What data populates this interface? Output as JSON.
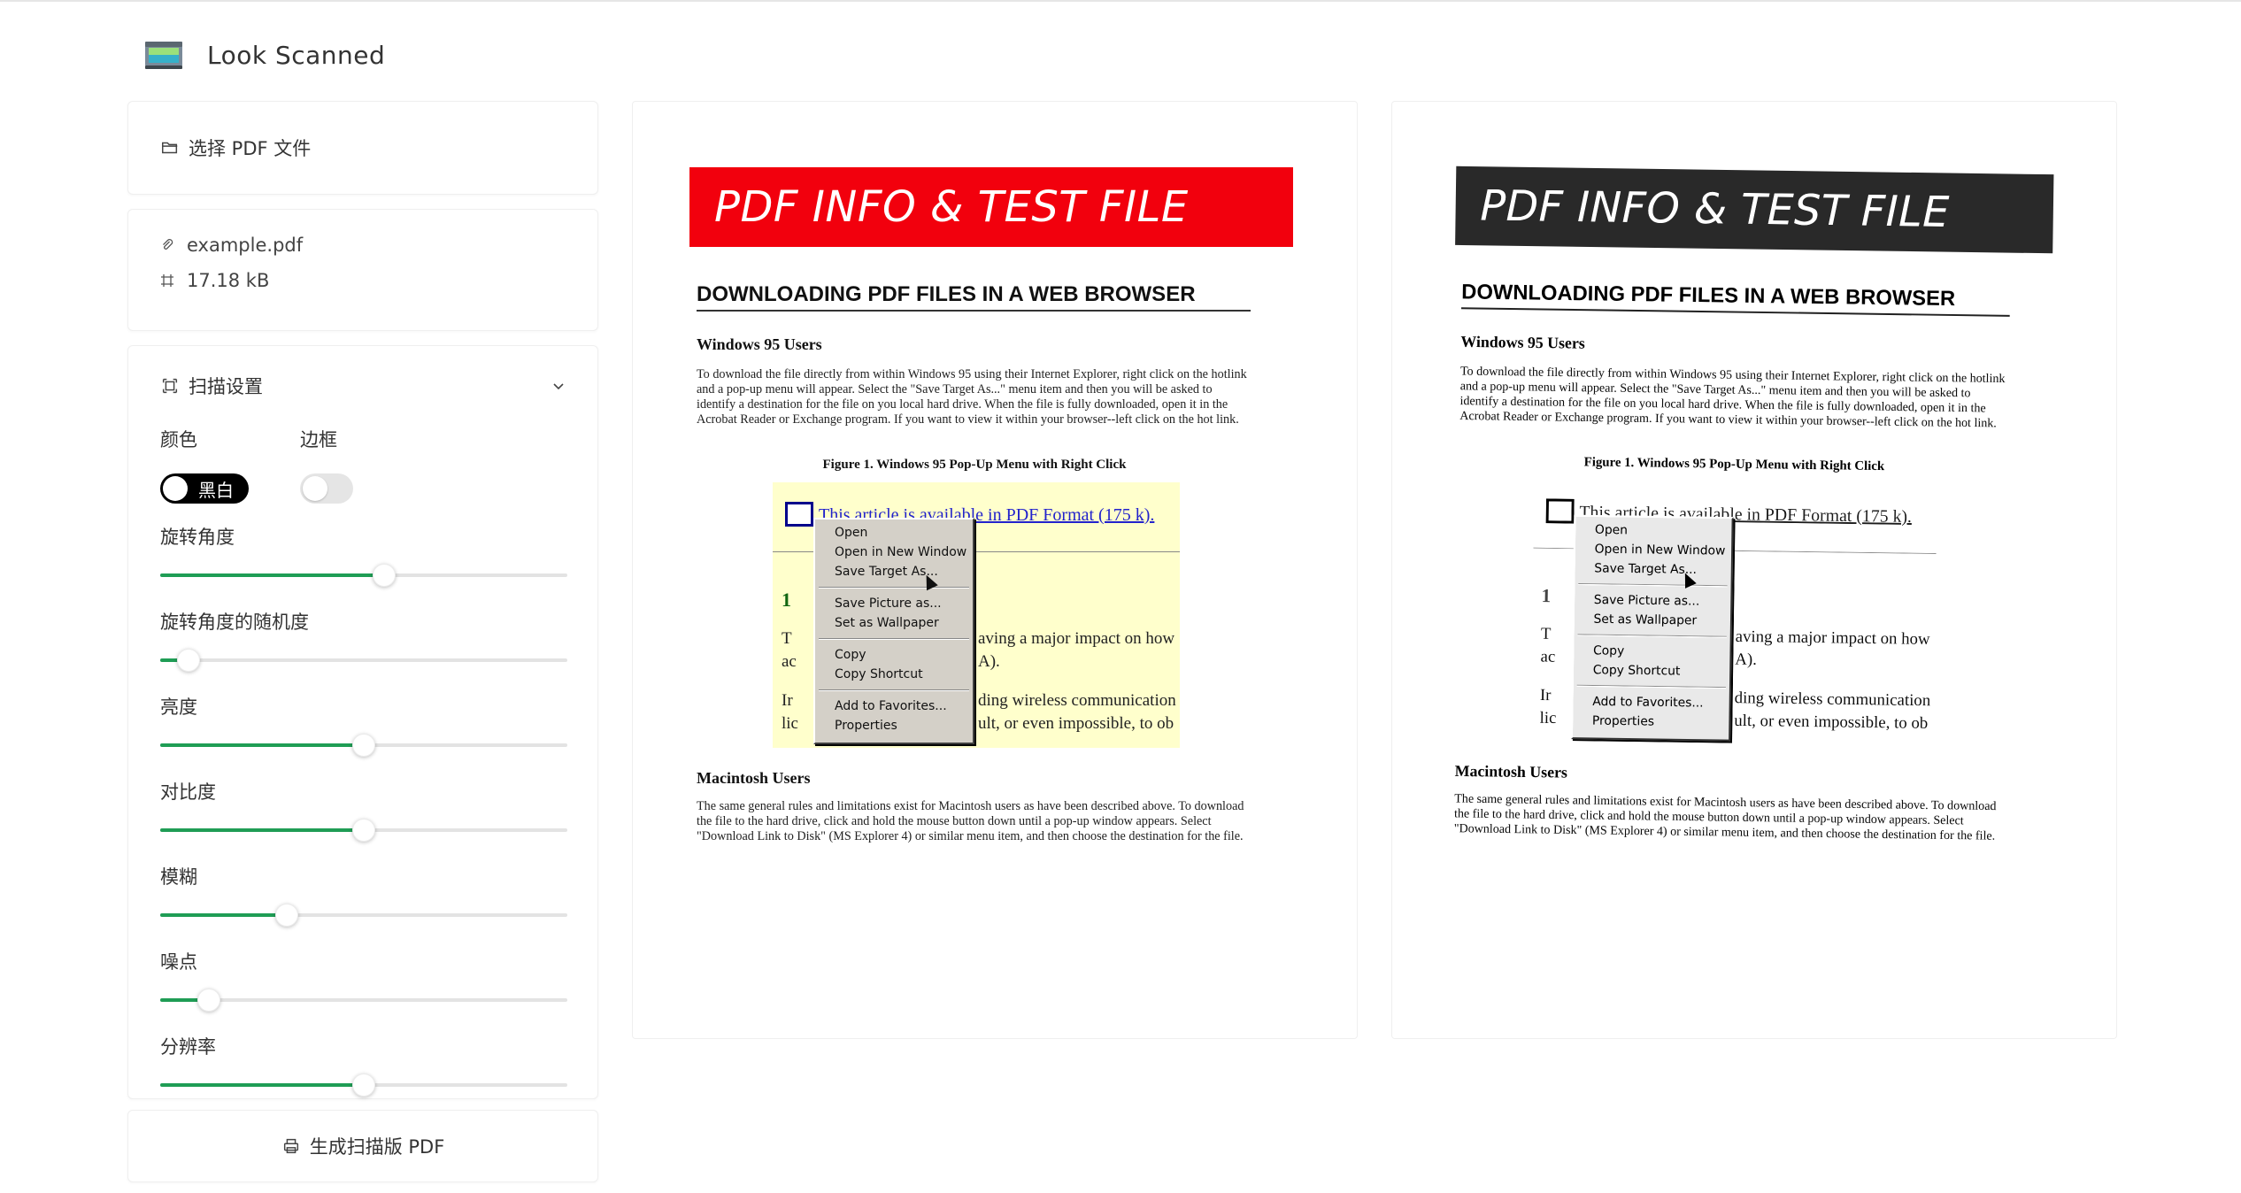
{
  "app": {
    "title": "Look Scanned",
    "logo_icon": "scanner-icon"
  },
  "sidebar": {
    "select_pdf_label": "选择 PDF 文件",
    "file": {
      "name": "example.pdf",
      "size": "17.18 kB"
    },
    "settings": {
      "title": "扫描设置",
      "color_label": "颜色",
      "border_label": "边框",
      "color_toggle_text": "黑白",
      "color_toggle_on": true,
      "border_toggle_on": false,
      "sliders": [
        {
          "label": "旋转角度",
          "value": 0.55
        },
        {
          "label": "旋转角度的随机度",
          "value": 0.07
        },
        {
          "label": "亮度",
          "value": 0.5
        },
        {
          "label": "对比度",
          "value": 0.5
        },
        {
          "label": "模糊",
          "value": 0.31
        },
        {
          "label": "噪点",
          "value": 0.12
        },
        {
          "label": "分辨率",
          "value": 0.5
        }
      ],
      "accent_color": "#1f9d55"
    },
    "generate_label": "生成扫描版 PDF"
  },
  "document": {
    "banner": "PDF INFO & TEST FILE",
    "heading": "DOWNLOADING PDF FILES IN A WEB BROWSER",
    "section1_title": "Windows 95 Users",
    "section1_text": "To download the file directly from within Windows 95 using their Internet Explorer, right click on the hotlink and a pop-up menu will appear. Select the \"Save Target As...\" menu item and then you will be asked to identify a destination for the file on you local hard drive. When the file is fully downloaded, open it in the Acrobat Reader or Exchange program. If you want to view it within your browser--left click on the hot link.",
    "figure_caption": "Figure 1. Windows 95 Pop-Up Menu with Right Click",
    "figure": {
      "link_text": "This article is available in PDF Format (175 k).",
      "bg_text_1": "1",
      "bg_text_2": "T",
      "bg_text_3": "aving a major impact on how",
      "bg_text_4": "ac",
      "bg_text_5": "A).",
      "bg_text_6": "Ir",
      "bg_text_7": "ding wireless communication :",
      "bg_text_8": "lic",
      "bg_text_9": "ult, or even impossible, to ob",
      "menu_items": [
        "Open",
        "Open in New Window",
        "Save Target As...",
        "Save Picture as...",
        "Set as Wallpaper",
        "Copy",
        "Copy Shortcut",
        "Add to Favorites...",
        "Properties"
      ]
    },
    "section2_title": "Macintosh Users",
    "section2_text": "The same general rules and limitations exist for Macintosh users as have been described above. To download the file to the hard drive, click and hold the mouse button down until a pop-up window appears. Select \"Download Link to Disk\" (MS Explorer 4) or similar menu item, and then choose the destination for the file."
  }
}
